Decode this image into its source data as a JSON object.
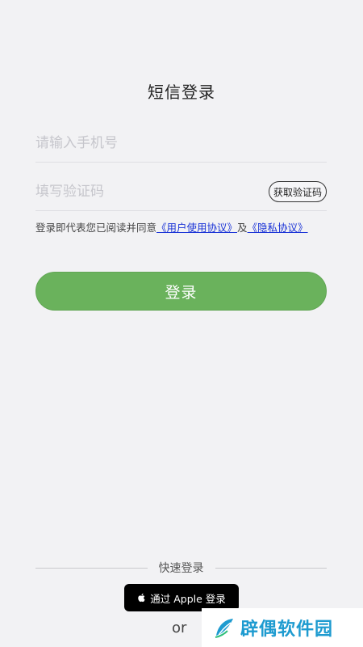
{
  "page": {
    "title": "短信登录"
  },
  "form": {
    "phone_placeholder": "请输入手机号",
    "code_placeholder": "填写验证码",
    "get_code_label": "获取验证码"
  },
  "agreement": {
    "prefix": "登录即代表您已阅读并同意",
    "user_agreement_link": "《用户使用协议》",
    "conjunction": "及",
    "privacy_link": "《隐私协议》"
  },
  "login_button": "登录",
  "quick_login": {
    "label": "快速登录",
    "apple_button": "通过 Apple 登录",
    "or_text": "or"
  },
  "watermark": {
    "text": "辟偶软件园"
  },
  "colors": {
    "background": "#f2f2f4",
    "accent_green": "#6ab25c",
    "link_blue": "#1a33d6",
    "apple_black": "#000000",
    "watermark_blue": "#1e9bd0"
  },
  "icons": {
    "apple": "apple-logo-icon",
    "watermark": "leaf-logo-icon"
  }
}
